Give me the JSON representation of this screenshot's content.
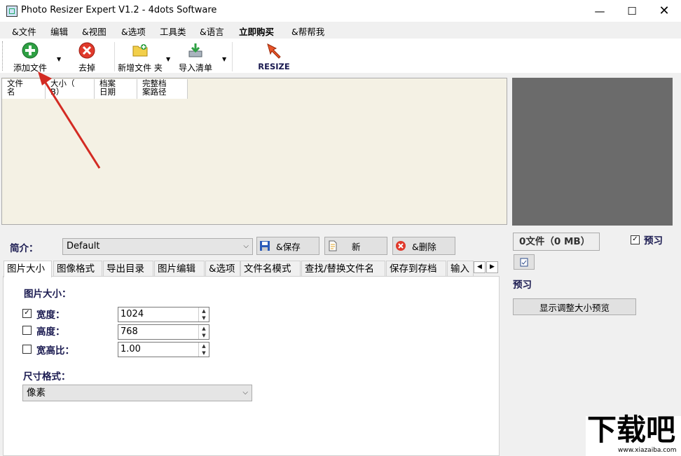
{
  "window": {
    "title": "Photo Resizer Expert V1.2 - 4dots Software"
  },
  "menu": [
    "&文件",
    "编辑",
    "&视图",
    "&选项",
    "工具类",
    "&语言",
    "立即购买",
    "&帮帮我"
  ],
  "toolbar": {
    "add_files": "添加文件",
    "remove": "去掉",
    "add_folder": "新增文件 夹",
    "import_list": "导入清单",
    "resize": "RESIZE"
  },
  "file_list": {
    "columns": [
      "文件\n名",
      "大小（\nB）",
      "档案\n日期",
      "完整档\n案路径"
    ]
  },
  "profile": {
    "label": "简介：",
    "value": "Default",
    "save": "&保存",
    "new": "新",
    "delete": "&删除"
  },
  "tabs": [
    "图片大小",
    "图像格式",
    "导出目录",
    "图片编辑",
    "&选项",
    "文件名模式",
    "查找/替换文件名",
    "保存到存档",
    "输入"
  ],
  "image_size": {
    "heading": "图片大小：",
    "width_label": "宽度：",
    "width_checked": true,
    "width_value": "1024",
    "height_label": "高度：",
    "height_checked": false,
    "height_value": "768",
    "ratio_label": "宽高比：",
    "ratio_checked": false,
    "ratio_value": "1.00",
    "unit_heading": "尺寸格式：",
    "unit_value": "像素"
  },
  "preview": {
    "status": "0文件（0 MB）",
    "checkbox_label": "预习",
    "checkbox_checked": true,
    "label": "预习",
    "show_button": "显示调整大小预览"
  },
  "watermark": {
    "main": "下载吧",
    "sub": "www.xiazaiba.com"
  },
  "colors": {
    "accent_text": "#1a1a50",
    "list_bg": "#f4f1e4",
    "preview_bg": "#6b6b6b"
  }
}
